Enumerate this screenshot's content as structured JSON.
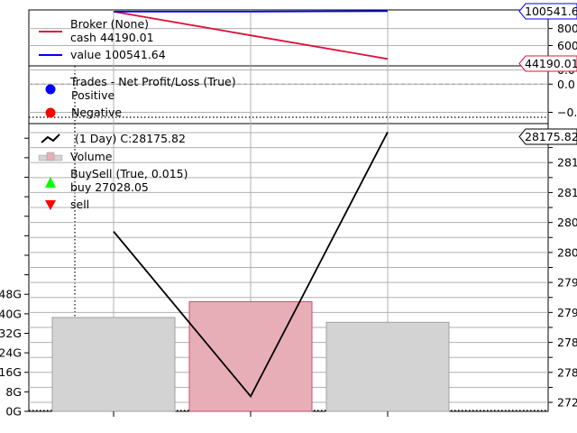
{
  "chart_data": [
    {
      "panel": "broker",
      "type": "line",
      "x": [
        1,
        2,
        3
      ],
      "ylim": [
        36000,
        102000
      ],
      "y_ticks": [
        "600",
        "800"
      ],
      "series": [
        {
          "name": "cash",
          "values": [
            100000,
            72000,
            44190.01
          ],
          "color": "#dc143c"
        },
        {
          "name": "value",
          "values": [
            100000,
            100000,
            100541.64
          ],
          "color": "#0000ff"
        }
      ],
      "legend": {
        "title": "Broker (None)",
        "cash_label": "cash 44190.01",
        "value_label": "value 100541.64"
      },
      "last_value_labels": {
        "value": "100541.6",
        "cash": "44190.01"
      }
    },
    {
      "panel": "trades",
      "type": "scatter",
      "ylim": [
        -0.28,
        0.13
      ],
      "y_ticks": [
        "0.0",
        "0.0",
        "−0."
      ],
      "series": [
        {
          "name": "Positive",
          "values": [],
          "color": "#0000ff"
        },
        {
          "name": "Negative",
          "values": [],
          "color": "#ff0000"
        }
      ],
      "legend": {
        "title": "Trades - Net Profit/Loss (True)",
        "pos_label": "Positive",
        "neg_label": "Negative"
      }
    },
    {
      "panel": "price",
      "type": "line",
      "x": [
        1,
        2,
        3
      ],
      "close": [
        28010,
        27735,
        28175.82
      ],
      "ylim": [
        27710,
        28190
      ],
      "volume": [
        38.5,
        45,
        36.5
      ],
      "volume_ylim": [
        0,
        118
      ],
      "volume_colors": [
        "#d3d3d3",
        "#e8aeb8",
        "#d3d3d3"
      ],
      "volume_ticks": [
        "0G",
        "8G",
        "16G",
        "24G",
        "32G",
        "40G",
        "48G"
      ],
      "price_ticks": [
        "272",
        "278",
        "278",
        "279",
        "279",
        "280",
        "280",
        "281",
        "281"
      ],
      "legend": {
        "close_label": "(1 Day) C:28175.82",
        "volume_label": "Volume",
        "buysell_label": "BuySell (True, 0.015)",
        "buy_label": "buy 27028.05",
        "sell_label": "sell"
      },
      "last_value_label": "28175.82"
    }
  ]
}
